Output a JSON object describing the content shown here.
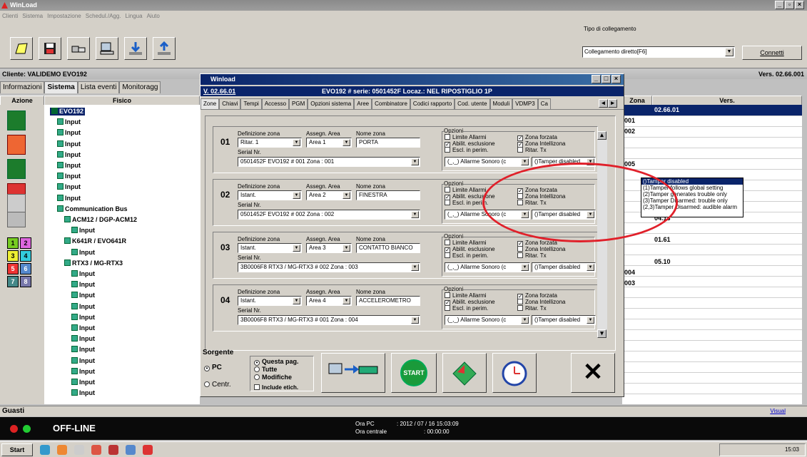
{
  "app": {
    "title": "WinLoad",
    "menu": [
      "Clienti",
      "Sistema",
      "Impostazione",
      "Schedul./Agg.",
      "Lingua",
      "Aiuto"
    ]
  },
  "connection": {
    "label": "Tipo di collegamento",
    "value": "Collegamento diretto[F6]",
    "connect": "Connetti"
  },
  "client": {
    "name": "Cliente: VALIDEMO EVO192",
    "version": "Vers. 02.66.001"
  },
  "tabs": [
    "Informazioni",
    "Sistema",
    "Lista eventi",
    "Monitoragg"
  ],
  "columns": {
    "azione": "Azione",
    "fisico": "Fisico",
    "zona": "Zona",
    "vers": "Vers."
  },
  "tree": [
    {
      "label": "EVO192",
      "level": 0
    },
    {
      "label": "Input",
      "level": 1
    },
    {
      "label": "Input",
      "level": 1
    },
    {
      "label": "Input",
      "level": 1
    },
    {
      "label": "Input",
      "level": 1
    },
    {
      "label": "Input",
      "level": 1
    },
    {
      "label": "Input",
      "level": 1
    },
    {
      "label": "Input",
      "level": 1
    },
    {
      "label": "Input",
      "level": 1
    },
    {
      "label": "Communication Bus",
      "level": 1
    },
    {
      "label": "ACM12 / DGP-ACM12",
      "level": 2
    },
    {
      "label": "Input",
      "level": 3
    },
    {
      "label": "K641R / EVO641R",
      "level": 2
    },
    {
      "label": "Input",
      "level": 3
    },
    {
      "label": "RTX3 / MG-RTX3",
      "level": 2
    },
    {
      "label": "Input",
      "level": 3
    },
    {
      "label": "Input",
      "level": 3
    },
    {
      "label": "Input",
      "level": 3
    },
    {
      "label": "Input",
      "level": 3
    },
    {
      "label": "Input",
      "level": 3
    },
    {
      "label": "Input",
      "level": 3
    },
    {
      "label": "Input",
      "level": 3
    },
    {
      "label": "Input",
      "level": 3
    },
    {
      "label": "Input",
      "level": 3
    },
    {
      "label": "Input",
      "level": 3
    },
    {
      "label": "Input",
      "level": 3
    },
    {
      "label": "Input",
      "level": 3
    }
  ],
  "grid": {
    "rows": [
      {
        "zona": "",
        "vers": "02.66.01"
      },
      {
        "zona": "001",
        "vers": ""
      },
      {
        "zona": "002",
        "vers": ""
      },
      {
        "zona": "",
        "vers": ""
      },
      {
        "zona": "",
        "vers": ""
      },
      {
        "zona": "005",
        "vers": ""
      },
      {
        "zona": "",
        "vers": ""
      },
      {
        "zona": "",
        "vers": ""
      },
      {
        "zona": "",
        "vers": ""
      },
      {
        "zona": "",
        "vers": ""
      },
      {
        "zona": "",
        "vers": "04.13"
      },
      {
        "zona": "",
        "vers": ""
      },
      {
        "zona": "",
        "vers": "01.61"
      },
      {
        "zona": "",
        "vers": ""
      },
      {
        "zona": "",
        "vers": "05.10"
      },
      {
        "zona": "004",
        "vers": ""
      },
      {
        "zona": "003",
        "vers": ""
      }
    ]
  },
  "dialog": {
    "title": "Winload",
    "version": "V. 02.66.01",
    "header": "EVO192 # serie: 0501452F Locaz.: NEL RIPOSTIGLIO 1P",
    "tabs": [
      "Zone",
      "Chiavi",
      "Tempi",
      "Accesso",
      "PGM",
      "Opzioni sistema",
      "Aree",
      "Combinatore",
      "Codici rapporto",
      "Cod. utente",
      "Moduli",
      "VDMP3",
      "Ca"
    ],
    "labels": {
      "def": "Definizione zona",
      "area": "Assegn. Area",
      "name": "Nome zona",
      "serial": "Serial Nr.",
      "opzioni": "Opzioni",
      "limite": "Limite Allarmi",
      "abilit": "Abilit. esclusione",
      "escl": "Escl. in perim.",
      "forzata": "Zona forzata",
      "intell": "Zona Intellizona",
      "ritar": "Ritar. Tx"
    },
    "zones": [
      {
        "num": "01",
        "def": "Ritar. 1",
        "area": "Area 1",
        "name": "PORTA",
        "serial": "0501452F EVO192      # 001 Zona  : 001",
        "alarm": "(_,_) Allarme Sonoro (c",
        "tamper": "()Tamper disabled",
        "limite": false,
        "abilit": true,
        "escl": false,
        "forzata": true,
        "intell": true,
        "ritar": false
      },
      {
        "num": "02",
        "def": "Istant.",
        "area": "Area 2",
        "name": "FINESTRA",
        "serial": "0501452F EVO192      # 002 Zona  : 002",
        "alarm": "(_,_) Allarme Sonoro (c",
        "tamper": "()Tamper disabled",
        "limite": false,
        "abilit": true,
        "escl": false,
        "forzata": true,
        "intell": false,
        "ritar": false
      },
      {
        "num": "03",
        "def": "Istant.",
        "area": "Area 3",
        "name": "CONTATTO BIANCO",
        "serial": "3B0006F8 RTX3 / MG-RTX3  # 002 Zona  : 003",
        "alarm": "(_,_) Allarme Sonoro (c",
        "tamper": "()Tamper disabled",
        "limite": false,
        "abilit": true,
        "escl": false,
        "forzata": true,
        "intell": false,
        "ritar": false
      },
      {
        "num": "04",
        "def": "Istant.",
        "area": "Area 4",
        "name": "ACCELEROMETRO",
        "serial": "3B0006F8 RTX3 / MG-RTX3  # 001 Zona  : 004",
        "alarm": "(_,_) Allarme Sonoro (c",
        "tamper": "()Tamper disabled",
        "limite": false,
        "abilit": true,
        "escl": false,
        "forzata": true,
        "intell": false,
        "ritar": false
      }
    ],
    "tamper_options": [
      "()Tamper disabled",
      "(1)Tamper follows global setting",
      "(2)Tamper generates trouble only",
      "(3)Tamper Disarmed: trouble only",
      "(2,3)Tamper Disarmed: audible alarm"
    ],
    "sorgente": {
      "label": "Sorgente",
      "pc": "PC",
      "centr": "Centr.",
      "questa": "Questa pag.",
      "tutte": "Tutte",
      "modifiche": "Modifiche",
      "include": "Include etich.",
      "start": "START"
    }
  },
  "status": {
    "guasti": "Guasti",
    "visual": "Visual",
    "state": "OFF-LINE",
    "ora_pc_label": "Ora PC",
    "ora_pc": ": 2012 / 07 / 16  15:03:09",
    "ora_centr_label": "Ora centrale",
    "ora_centr": ":   00:00:00"
  },
  "taskbar": {
    "start": "Start",
    "clock": "15:03"
  }
}
